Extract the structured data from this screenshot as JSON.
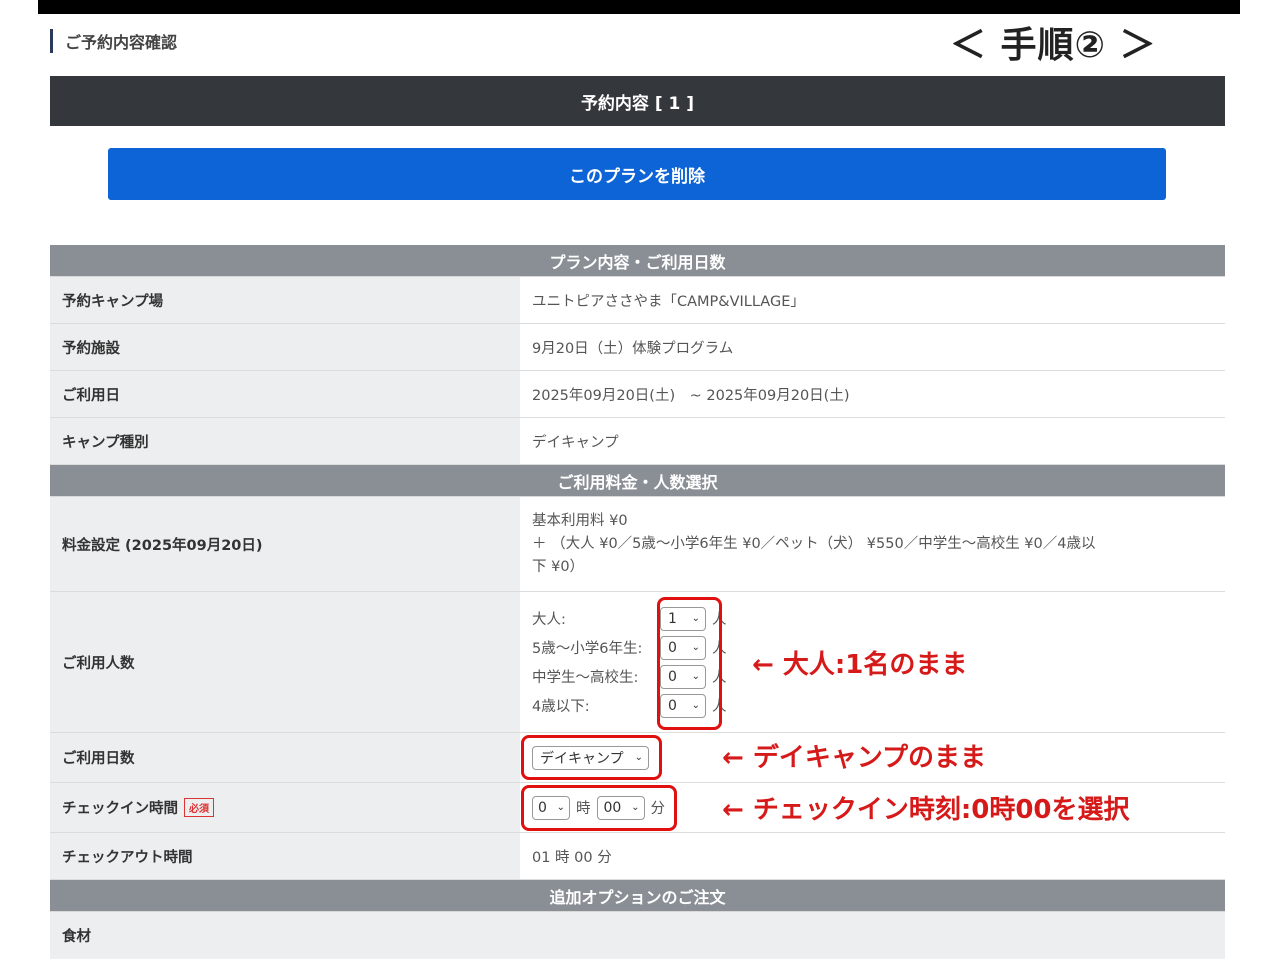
{
  "page": {
    "section_heading": "ご予約内容確認",
    "step_label": "＜ 手順② ＞",
    "reservation_header": "予約内容 [ 1 ]",
    "delete_button": "このプランを削除"
  },
  "categories": {
    "plan": "プラン内容・ご利用日数",
    "fees": "ご利用料金・人数選択",
    "options": "追加オプションのご注文"
  },
  "plan_rows": [
    {
      "label": "予約キャンプ場",
      "value": "ユニトピアささやま「CAMP&VILLAGE」"
    },
    {
      "label": "予約施設",
      "value": "9月20日（土）体験プログラム"
    },
    {
      "label": "ご利用日",
      "value": "2025年09月20日(土)　~ 2025年09月20日(土)"
    },
    {
      "label": "キャンプ種別",
      "value": "デイキャンプ"
    }
  ],
  "fee_setting": {
    "label": "料金設定 (2025年09月20日)",
    "line1": "基本利用料 ¥0",
    "line2": "＋ （大人 ¥0／5歳～小学6年生 ¥0／ペット（犬） ¥550／中学生～高校生 ¥0／4歳以",
    "line3": "下 ¥0）"
  },
  "people": {
    "label": "ご利用人数",
    "unit": "人",
    "rows": [
      {
        "label": "大人:",
        "value": "1"
      },
      {
        "label": "5歳～小学6年生:",
        "value": "0"
      },
      {
        "label": "中学生～高校生:",
        "value": "0"
      },
      {
        "label": "4歳以下:",
        "value": "0"
      }
    ]
  },
  "days": {
    "label": "ご利用日数",
    "value": "デイキャンプ"
  },
  "checkin": {
    "label": "チェックイン時間",
    "required": "必須",
    "hour": "0",
    "hour_unit": "時",
    "minute": "00",
    "minute_unit": "分"
  },
  "checkout": {
    "label": "チェックアウト時間",
    "value": "01 時 00 分"
  },
  "option_rows": [
    {
      "label": "食材"
    }
  ],
  "annotations": {
    "people": "← 大人:1名のまま",
    "days": "← デイキャンプのまま",
    "checkin": "← チェックイン時刻:0時00を選択"
  },
  "colors": {
    "header_dark": "#34373b",
    "button_blue": "#0d64d6",
    "category_gray": "#8a8f95",
    "label_bg": "#eceeef",
    "annotation_red": "#d61a1a"
  }
}
